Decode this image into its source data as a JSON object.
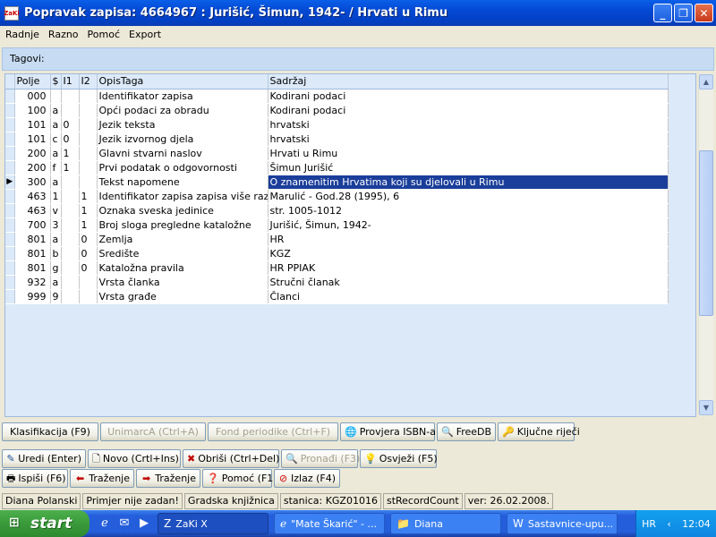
{
  "window": {
    "title": "Popravak zapisa: 4664967 : Jurišić, Šimun, 1942- / Hrvati u Rimu",
    "app_icon": "ZaKi"
  },
  "menu": [
    "Radnje",
    "Razno",
    "Pomoć",
    "Export"
  ],
  "tags_label": "Tagovi:",
  "grid": {
    "headers": [
      "Polje",
      "$",
      "I1",
      "I2",
      "OpisTaga",
      "Sadržaj"
    ],
    "rows": [
      {
        "polje": "000",
        "sub": "",
        "i1": "",
        "i2": "",
        "opis": "Identifikator zapisa",
        "sadrzaj": "Kodirani podaci"
      },
      {
        "polje": "100",
        "sub": "a",
        "i1": "",
        "i2": "",
        "opis": "Opći podaci za obradu",
        "sadrzaj": "Kodirani podaci"
      },
      {
        "polje": "101",
        "sub": "a",
        "i1": "0",
        "i2": "",
        "opis": "Jezik teksta",
        "sadrzaj": "hrvatski"
      },
      {
        "polje": "101",
        "sub": "c",
        "i1": "0",
        "i2": "",
        "opis": "Jezik izvornog djela",
        "sadrzaj": "hrvatski"
      },
      {
        "polje": "200",
        "sub": "a",
        "i1": "1",
        "i2": "",
        "opis": "Glavni stvarni naslov",
        "sadrzaj": "Hrvati u Rimu"
      },
      {
        "polje": "200",
        "sub": "f",
        "i1": "1",
        "i2": "",
        "opis": "Prvi podatak o odgovornosti",
        "sadrzaj": "Šimun Jurišić"
      },
      {
        "polje": "300",
        "sub": "a",
        "i1": "",
        "i2": "",
        "opis": "Tekst napomene",
        "sadrzaj": "O znamenitim Hrvatima koji su djelovali u Rimu"
      },
      {
        "polje": "463",
        "sub": "1",
        "i1": "",
        "i2": "1",
        "opis": "Identifikator zapisa zapisa više razine",
        "sadrzaj": "Marulić - God.28 (1995), 6"
      },
      {
        "polje": "463",
        "sub": "v",
        "i1": "",
        "i2": "1",
        "opis": "Oznaka sveska jedinice",
        "sadrzaj": "str. 1005-1012"
      },
      {
        "polje": "700",
        "sub": "3",
        "i1": "",
        "i2": "1",
        "opis": "Broj sloga pregledne kataložne",
        "sadrzaj": "Jurišić, Šimun, 1942-"
      },
      {
        "polje": "801",
        "sub": "a",
        "i1": "",
        "i2": "0",
        "opis": "Zemlja",
        "sadrzaj": "HR"
      },
      {
        "polje": "801",
        "sub": "b",
        "i1": "",
        "i2": "0",
        "opis": "Središte",
        "sadrzaj": "KGZ"
      },
      {
        "polje": "801",
        "sub": "g",
        "i1": "",
        "i2": "0",
        "opis": "Kataložna pravila",
        "sadrzaj": "HR PPIAK"
      },
      {
        "polje": "932",
        "sub": "a",
        "i1": "",
        "i2": "",
        "opis": "Vrsta članka",
        "sadrzaj": "Stručni članak"
      },
      {
        "polje": "999",
        "sub": "9",
        "i1": "",
        "i2": "",
        "opis": "Vrsta građe",
        "sadrzaj": "Članci"
      }
    ],
    "selected_row": 6
  },
  "toolbar1": [
    {
      "label": "Klasifikacija (F9)",
      "icon": "",
      "enabled": true
    },
    {
      "label": "UnimarcA (Ctrl+A)",
      "icon": "",
      "enabled": false
    },
    {
      "label": "Fond periodike (Ctrl+F)",
      "icon": "",
      "enabled": false
    },
    {
      "label": "Provjera  ISBN-a",
      "icon": "globe-icon",
      "enabled": true
    },
    {
      "label": "FreeDB",
      "icon": "magnifier-icon",
      "enabled": true
    },
    {
      "label": "Ključne riječi",
      "icon": "key-icon",
      "enabled": true
    }
  ],
  "toolbar2": [
    {
      "label": "Uredi (Enter)",
      "icon": "edit-icon",
      "enabled": true
    },
    {
      "label": "Novo (Crtl+Ins)",
      "icon": "new-doc-icon",
      "enabled": true
    },
    {
      "label": "Obriši (Ctrl+Del)",
      "icon": "delete-x-icon",
      "enabled": true
    },
    {
      "label": "Pronađi (F3)",
      "icon": "find-icon",
      "enabled": false
    },
    {
      "label": "Osvježi (F5)",
      "icon": "bulb-icon",
      "enabled": true
    }
  ],
  "toolbar3": [
    {
      "label": "Ispiši (F6)",
      "icon": "print-icon",
      "enabled": true
    },
    {
      "label": "Traženje",
      "icon": "arrow-left-icon",
      "enabled": true
    },
    {
      "label": "Traženje",
      "icon": "arrow-right-icon",
      "enabled": true
    },
    {
      "label": "Pomoć (F1)",
      "icon": "help-icon",
      "enabled": true
    },
    {
      "label": "Izlaz (F4)",
      "icon": "exit-icon",
      "enabled": true
    }
  ],
  "status": [
    "Diana Polanski",
    "Primjer nije zadan!",
    "Gradska knjižnica",
    "stanica: KGZ01016",
    "stRecordCount",
    "ver: 26.02.2008."
  ],
  "taskbar": {
    "start": "start",
    "tasks": [
      {
        "label": "ZaKi X",
        "icon": "zaki-icon",
        "active": true
      },
      {
        "label": "\"Mate Škarić\" - ...",
        "icon": "ie-icon",
        "active": false
      },
      {
        "label": "Diana",
        "icon": "folder-icon",
        "active": false
      },
      {
        "label": "Sastavnice-upu...",
        "icon": "word-icon",
        "active": false
      }
    ],
    "lang": "HR",
    "clock": "12:04"
  }
}
